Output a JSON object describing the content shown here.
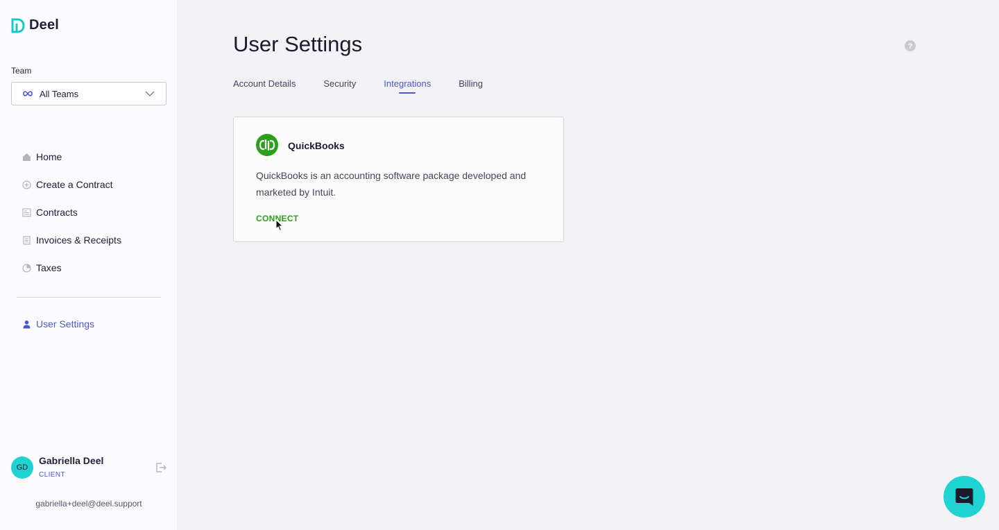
{
  "app": {
    "brand": "Deel",
    "colors": {
      "accent": "#4a56c9",
      "teal": "#1fd3d3",
      "quickbooks_green": "#2ca01c"
    }
  },
  "sidebar": {
    "team_label": "Team",
    "team_select_value": "All Teams",
    "team_select_icon": "infinity-icon",
    "items": [
      {
        "label": "Home",
        "icon": "home-icon"
      },
      {
        "label": "Create a Contract",
        "icon": "plus-circle-icon"
      },
      {
        "label": "Contracts",
        "icon": "contract-icon"
      },
      {
        "label": "Invoices & Receipts",
        "icon": "receipt-icon"
      },
      {
        "label": "Taxes",
        "icon": "pie-chart-icon"
      }
    ],
    "active_item": {
      "label": "User Settings",
      "icon": "user-icon"
    }
  },
  "user": {
    "initials": "GD",
    "name": "Gabriella Deel",
    "role": "CLIENT",
    "email": "gabriella+deel@deel.support"
  },
  "main": {
    "title": "User Settings",
    "tabs": [
      {
        "label": "Account Details",
        "active": false
      },
      {
        "label": "Security",
        "active": false
      },
      {
        "label": "Integrations",
        "active": true
      },
      {
        "label": "Billing",
        "active": false
      }
    ],
    "integration": {
      "name": "QuickBooks",
      "logo_text": "qb",
      "description": "QuickBooks is an accounting software package developed and marketed by Intuit.",
      "action": "CONNECT"
    }
  }
}
